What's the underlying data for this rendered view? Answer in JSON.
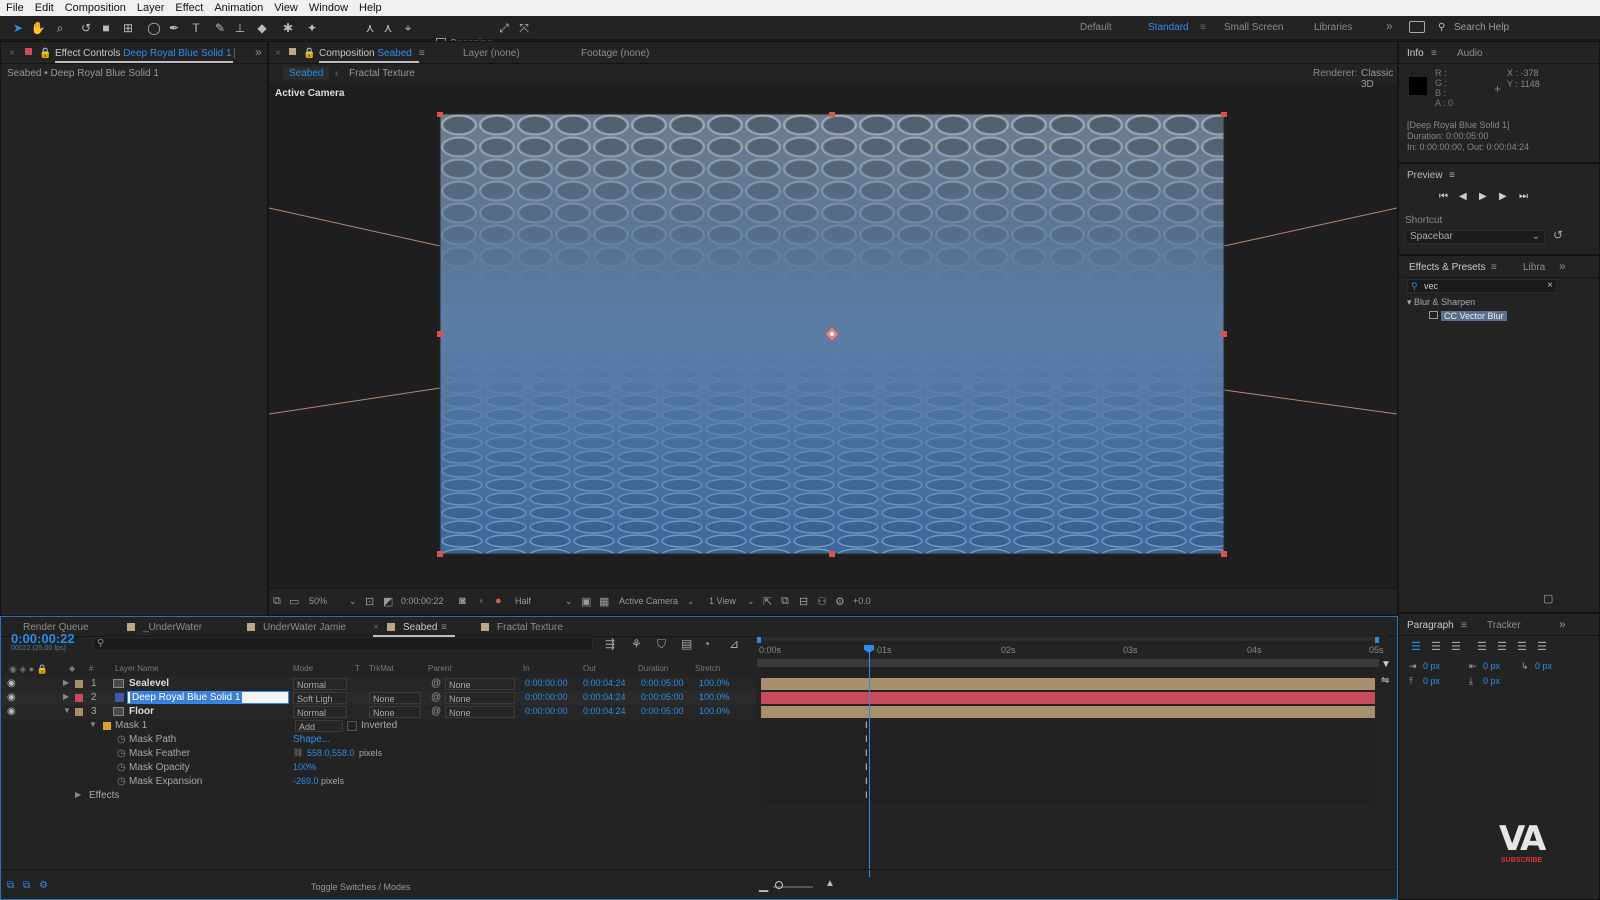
{
  "menu": [
    "File",
    "Edit",
    "Composition",
    "Layer",
    "Effect",
    "Animation",
    "View",
    "Window",
    "Help"
  ],
  "toolbar": {
    "snapping_label": "Snapping",
    "workspaces": [
      "Default",
      "Standard",
      "Small Screen",
      "Libraries"
    ],
    "active_workspace": "Standard",
    "search_help_placeholder": "Search Help"
  },
  "effect_controls": {
    "tab_prefix": "Effect Controls",
    "tab_layer": "Deep Royal Blue Solid 1",
    "breadcrumb": "Seabed • Deep Royal Blue Solid 1"
  },
  "composition": {
    "tab_prefix": "Composition",
    "tab_name": "Seabed",
    "layer_tab": "Layer (none)",
    "footage_tab": "Footage (none)",
    "subtabs": [
      "Seabed",
      "Fractal Texture"
    ],
    "renderer_label": "Renderer:",
    "renderer_value": "Classic 3D",
    "camera_label": "Active Camera",
    "footer": {
      "zoom": "50%",
      "timecode": "0:00:00:22",
      "resolution": "Half",
      "view": "Active Camera",
      "views": "1 View",
      "exposure": "+0.0"
    }
  },
  "info": {
    "tabs": [
      "Info",
      "Audio"
    ],
    "channels": [
      "R :",
      "G :",
      "B :",
      "A : 0"
    ],
    "x": "X : -378",
    "y": "Y : 1148",
    "layer_name": "[Deep Royal Blue Solid 1]",
    "duration": "Duration: 0:00:05:00",
    "in_out": "In: 0:00:00:00, Out: 0:00:04:24"
  },
  "preview": {
    "title": "Preview",
    "shortcut_label": "Shortcut",
    "shortcut_value": "Spacebar"
  },
  "effects_presets": {
    "tabs": [
      "Effects & Presets",
      "Libra"
    ],
    "search_value": "vec",
    "category": "Blur & Sharpen",
    "item": "CC Vector Blur"
  },
  "paragraph": {
    "tabs": [
      "Paragraph",
      "Tracker"
    ],
    "values": [
      "0 px",
      "0 px",
      "0 px",
      "0 px",
      "0 px"
    ]
  },
  "timeline": {
    "tabs": [
      "Render Queue",
      "_UnderWater",
      "UnderWater Jamie",
      "Seabed",
      "Fractal Texture"
    ],
    "active_tab": "Seabed",
    "timecode": "0:00:00:22",
    "fps_info": "00022 (25.00 fps)",
    "columns": [
      "Layer Name",
      "Mode",
      "T",
      "TrkMat",
      "Parent",
      "In",
      "Out",
      "Duration",
      "Stretch"
    ],
    "ruler": [
      "0:00s",
      "01s",
      "02s",
      "03s",
      "04s",
      "05s"
    ],
    "layers": [
      {
        "num": "1",
        "name": "Sealevel",
        "mode": "Normal",
        "trkmat": "",
        "parent": "None",
        "in": "0:00:00:00",
        "out": "0:00:04:24",
        "duration": "0:00:05:00",
        "stretch": "100.0%",
        "color": "#a88f6e"
      },
      {
        "num": "2",
        "name": "Deep Royal Blue Solid 1",
        "mode": "Soft Ligh",
        "trkmat": "None",
        "parent": "None",
        "in": "0:00:00:00",
        "out": "0:00:04:24",
        "duration": "0:00:05:00",
        "stretch": "100.0%",
        "color": "#c94a5a"
      },
      {
        "num": "3",
        "name": "Floor",
        "mode": "Normal",
        "trkmat": "None",
        "parent": "None",
        "in": "0:00:00:00",
        "out": "0:00:04:24",
        "duration": "0:00:05:00",
        "stretch": "100.0%",
        "color": "#a88f6e"
      }
    ],
    "mask": {
      "name": "Mask 1",
      "mode": "Add",
      "inverted_label": "Inverted",
      "props": [
        {
          "label": "Mask Path",
          "value": "Shape..."
        },
        {
          "label": "Mask Feather",
          "value": "558.0,558.0",
          "unit": "pixels"
        },
        {
          "label": "Mask Opacity",
          "value": "100%",
          "unit": ""
        },
        {
          "label": "Mask Expansion",
          "value": "-269.0",
          "unit": "pixels"
        }
      ]
    },
    "effects_label": "Effects",
    "toggle_label": "Toggle Switches / Modes"
  },
  "watermark": {
    "text": "VA",
    "subtitle": "SUBSCRIBE"
  },
  "colors": {
    "accent": "#2d8ceb",
    "panel": "#232323",
    "label_red": "#c94a5a",
    "label_tan": "#a88f6e"
  }
}
